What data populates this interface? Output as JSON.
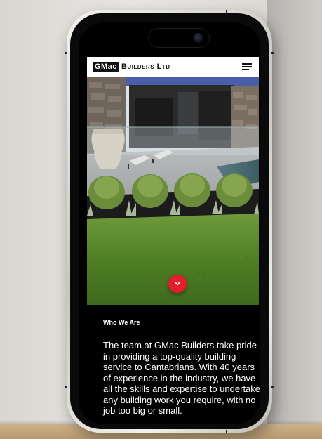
{
  "site": {
    "logo_mark": "GMac",
    "logo_text": "Builders Ltd",
    "menu_icon": "hamburger-menu-icon"
  },
  "hero": {
    "scroll_button_icon": "chevron-down-icon",
    "accent_color": "#e11e2a"
  },
  "about": {
    "heading": "Who We Are",
    "body": "The team at GMac Builders take pride in providing a top-quality building service to Cantabrians. With 40 years of experience in the industry, we have all the skills and expertise to undertake any building work you require, with no job too big or small."
  }
}
